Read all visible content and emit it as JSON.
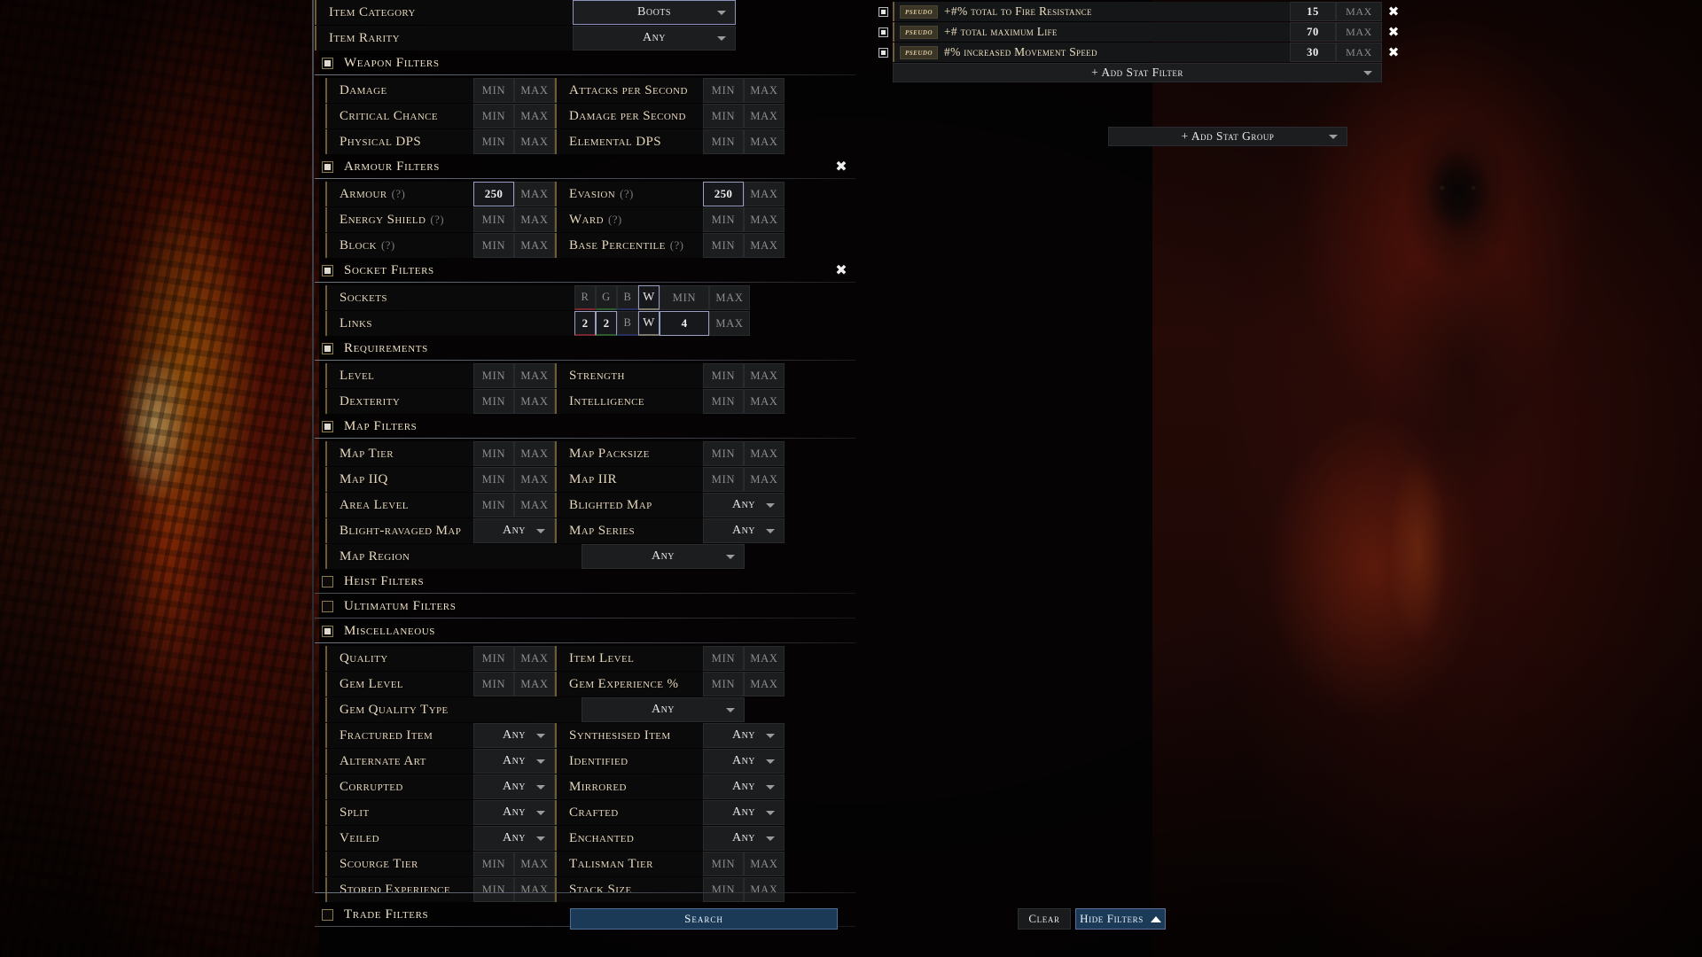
{
  "top_filters": [
    {
      "label": "Item Category",
      "type": "select-wide",
      "value": "Boots",
      "selected": true
    },
    {
      "label": "Item Rarity",
      "type": "select-wide",
      "value": "Any",
      "selected": false
    }
  ],
  "sections": [
    {
      "name": "Weapon Filters",
      "checked": true,
      "closable": false,
      "rows": [
        {
          "left_label": "Damage",
          "left_min": "MIN",
          "left_max": "MAX",
          "right_label": "Attacks per Second",
          "right_min": "MIN",
          "right_max": "MAX"
        },
        {
          "left_label": "Critical Chance",
          "left_min": "MIN",
          "left_max": "MAX",
          "right_label": "Damage per Second",
          "right_min": "MIN",
          "right_max": "MAX"
        },
        {
          "left_label": "Physical DPS",
          "left_min": "MIN",
          "left_max": "MAX",
          "right_label": "Elemental DPS",
          "right_min": "MIN",
          "right_max": "MAX"
        }
      ]
    },
    {
      "name": "Armour Filters",
      "checked": true,
      "closable": true,
      "rows": [
        {
          "left_label": "Armour",
          "left_hint": "(?)",
          "left_min": "250",
          "left_min_filled": true,
          "left_min_selected": true,
          "left_max": "MAX",
          "right_label": "Evasion",
          "right_hint": "(?)",
          "right_min": "250",
          "right_min_filled": true,
          "right_min_selected": true,
          "right_max": "MAX"
        },
        {
          "left_label": "Energy Shield",
          "left_hint": "(?)",
          "left_min": "MIN",
          "left_max": "MAX",
          "right_label": "Ward",
          "right_hint": "(?)",
          "right_min": "MIN",
          "right_max": "MAX"
        },
        {
          "left_label": "Block",
          "left_hint": "(?)",
          "left_min": "MIN",
          "left_max": "MAX",
          "right_label": "Base Percentile",
          "right_hint": "(?)",
          "right_min": "MIN",
          "right_max": "MAX"
        }
      ]
    },
    {
      "name": "Socket Filters",
      "checked": true,
      "closable": true,
      "socket_rows": [
        {
          "label": "Sockets",
          "r": "R",
          "g": "G",
          "b": "B",
          "w": "W",
          "min": "MIN",
          "max": "MAX",
          "r_filled": false,
          "g_filled": false,
          "b_filled": false,
          "w_filled": false,
          "min_filled": false,
          "w_selected": true
        },
        {
          "label": "Links",
          "r": "2",
          "g": "2",
          "b": "B",
          "w": "W",
          "min": "4",
          "max": "MAX",
          "r_filled": true,
          "g_filled": true,
          "b_filled": false,
          "w_filled": false,
          "min_filled": true,
          "w_selected": true
        }
      ]
    },
    {
      "name": "Requirements",
      "checked": true,
      "closable": false,
      "rows": [
        {
          "left_label": "Level",
          "left_min": "MIN",
          "left_max": "MAX",
          "right_label": "Strength",
          "right_min": "MIN",
          "right_max": "MAX"
        },
        {
          "left_label": "Dexterity",
          "left_min": "MIN",
          "left_max": "MAX",
          "right_label": "Intelligence",
          "right_min": "MIN",
          "right_max": "MAX"
        }
      ]
    },
    {
      "name": "Map Filters",
      "checked": true,
      "closable": false,
      "rows": [
        {
          "left_label": "Map Tier",
          "left_min": "MIN",
          "left_max": "MAX",
          "right_label": "Map Packsize",
          "right_min": "MIN",
          "right_max": "MAX"
        },
        {
          "left_label": "Map IIQ",
          "left_min": "MIN",
          "left_max": "MAX",
          "right_label": "Map IIR",
          "right_min": "MIN",
          "right_max": "MAX"
        },
        {
          "left_label": "Area Level",
          "left_min": "MIN",
          "left_max": "MAX",
          "right_label": "Blighted Map",
          "right_select": "Any"
        },
        {
          "left_label": "Blight-ravaged Map",
          "left_select": "Any",
          "right_label": "Map Series",
          "right_select": "Any"
        }
      ],
      "wide_rows": [
        {
          "label": "Map Region",
          "value": "Any"
        }
      ]
    },
    {
      "name": "Heist Filters",
      "checked": false,
      "closable": false,
      "rows": []
    },
    {
      "name": "Ultimatum Filters",
      "checked": false,
      "closable": false,
      "rows": []
    },
    {
      "name": "Miscellaneous",
      "checked": true,
      "closable": false,
      "rows": [
        {
          "left_label": "Quality",
          "left_min": "MIN",
          "left_max": "MAX",
          "right_label": "Item Level",
          "right_min": "MIN",
          "right_max": "MAX"
        },
        {
          "left_label": "Gem Level",
          "left_min": "MIN",
          "left_max": "MAX",
          "right_label": "Gem Experience %",
          "right_min": "MIN",
          "right_max": "MAX"
        }
      ],
      "wide_rows_mid": [
        {
          "label": "Gem Quality Type",
          "value": "Any"
        }
      ],
      "rows2": [
        {
          "left_label": "Fractured Item",
          "left_select": "Any",
          "right_label": "Synthesised Item",
          "right_select": "Any"
        },
        {
          "left_label": "Alternate Art",
          "left_select": "Any",
          "right_label": "Identified",
          "right_select": "Any"
        },
        {
          "left_label": "Corrupted",
          "left_select": "Any",
          "right_label": "Mirrored",
          "right_select": "Any"
        },
        {
          "left_label": "Split",
          "left_select": "Any",
          "right_label": "Crafted",
          "right_select": "Any"
        },
        {
          "left_label": "Veiled",
          "left_select": "Any",
          "right_label": "Enchanted",
          "right_select": "Any"
        },
        {
          "left_label": "Scourge Tier",
          "left_min": "MIN",
          "left_max": "MAX",
          "right_label": "Talisman Tier",
          "right_min": "MIN",
          "right_max": "MAX"
        },
        {
          "left_label": "Stored Experience",
          "left_min": "MIN",
          "left_max": "MAX",
          "right_label": "Stack Size",
          "right_min": "MIN",
          "right_max": "MAX"
        }
      ]
    },
    {
      "name": "Trade Filters",
      "checked": false,
      "closable": false,
      "rows": []
    }
  ],
  "stat_group": {
    "filters": [
      {
        "tag": "pseudo",
        "text": "+#% total to Fire Resistance",
        "min": "15",
        "max": "MAX",
        "checked": true
      },
      {
        "tag": "pseudo",
        "text": "+# total maximum Life",
        "min": "70",
        "max": "MAX",
        "checked": true
      },
      {
        "tag": "pseudo",
        "text": "#% increased Movement Speed",
        "min": "30",
        "max": "MAX",
        "checked": true
      }
    ],
    "add_stat_filter_label": "+ Add Stat Filter",
    "add_stat_group_label": "+ Add Stat Group"
  },
  "footer": {
    "search_label": "Search",
    "clear_label": "Clear",
    "hide_filters_label": "Hide Filters"
  },
  "colors": {
    "accent_blue": "#1b3a57",
    "label_gold": "#e8d9bd",
    "pseudo_tag": "#3b3527"
  }
}
